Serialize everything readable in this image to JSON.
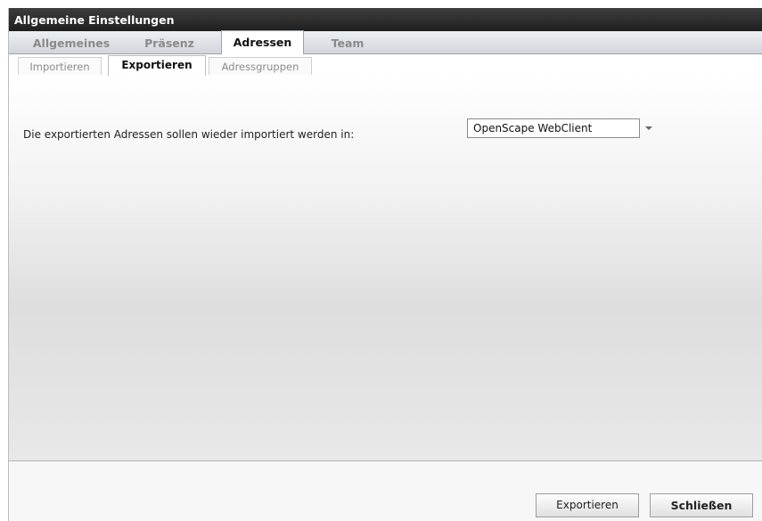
{
  "window": {
    "title": "Allgemeine Einstellungen"
  },
  "main_tabs": [
    {
      "label": "Allgemeines",
      "active": false
    },
    {
      "label": "Präsenz",
      "active": false
    },
    {
      "label": "Adressen",
      "active": true
    },
    {
      "label": "Team",
      "active": false
    }
  ],
  "sub_tabs": [
    {
      "label": "Importieren",
      "active": false
    },
    {
      "label": "Exportieren",
      "active": true
    },
    {
      "label": "Adressgruppen",
      "active": false
    }
  ],
  "export": {
    "label": "Die exportierten Adressen sollen wieder importiert werden in:",
    "target_value": "OpenScape WebClient"
  },
  "footer": {
    "export_button": "Exportieren",
    "close_button": "Schließen"
  }
}
